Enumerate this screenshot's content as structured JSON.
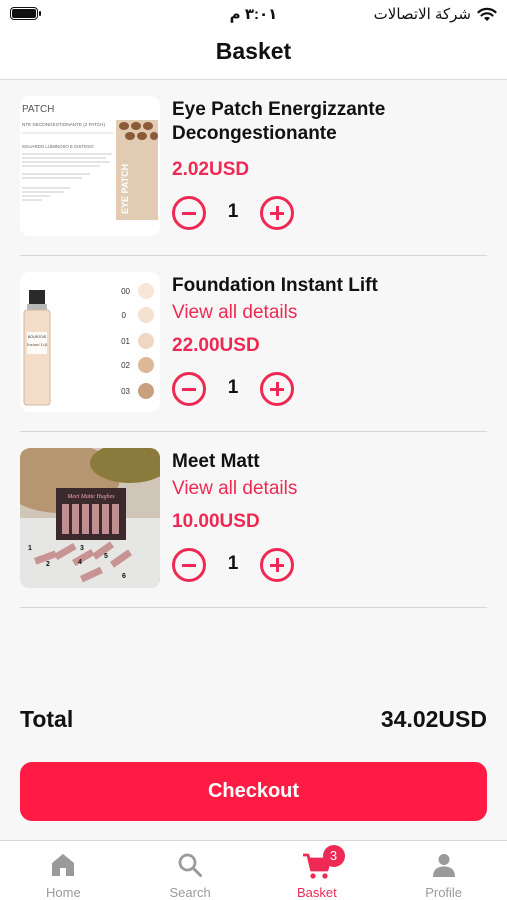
{
  "status_bar": {
    "time": "٣:٠١ م",
    "carrier": "شركة الاتصالات",
    "icons": [
      "battery-icon",
      "wifi-icon"
    ]
  },
  "header": {
    "title": "Basket"
  },
  "items": [
    {
      "name": "Eye Patch Energizzante Decongestionante",
      "price": "2.02USD",
      "quantity": "1",
      "thumbnail": {
        "label": "PATCH",
        "subtitle": "NTE DECONGESTIONANTE (2 PATCH)",
        "line": "SGUARDO LUMINOSO E DISTESO",
        "side": "EYE PATCH"
      }
    },
    {
      "name": "Foundation Instant Lift",
      "link": "View all details",
      "price": "22.00USD",
      "quantity": "1",
      "thumbnail": {
        "shades": [
          "00",
          "0",
          "01",
          "02",
          "03"
        ],
        "brand": "BOURJOIS",
        "product": "Instant Lift"
      }
    },
    {
      "name": "Meet Matt",
      "link": "View all details",
      "price": "10.00USD",
      "quantity": "1",
      "thumbnail": {
        "box_label": "Meet Matte Hughes",
        "numbers": [
          "1",
          "2",
          "3",
          "4",
          "5",
          "6"
        ]
      }
    }
  ],
  "summary": {
    "total_label": "Total",
    "total_value": "34.02USD"
  },
  "checkout": {
    "label": "Checkout"
  },
  "tabs": [
    {
      "label": "Home",
      "icon": "home-icon",
      "active": false
    },
    {
      "label": "Search",
      "icon": "search-icon",
      "active": false
    },
    {
      "label": "Basket",
      "icon": "cart-icon",
      "active": true,
      "badge": "3"
    },
    {
      "label": "Profile",
      "icon": "person-icon",
      "active": false
    }
  ],
  "colors": {
    "accent": "#ee2a54",
    "checkout": "#ff1b44",
    "inactive_tab": "#9a9a9a"
  }
}
